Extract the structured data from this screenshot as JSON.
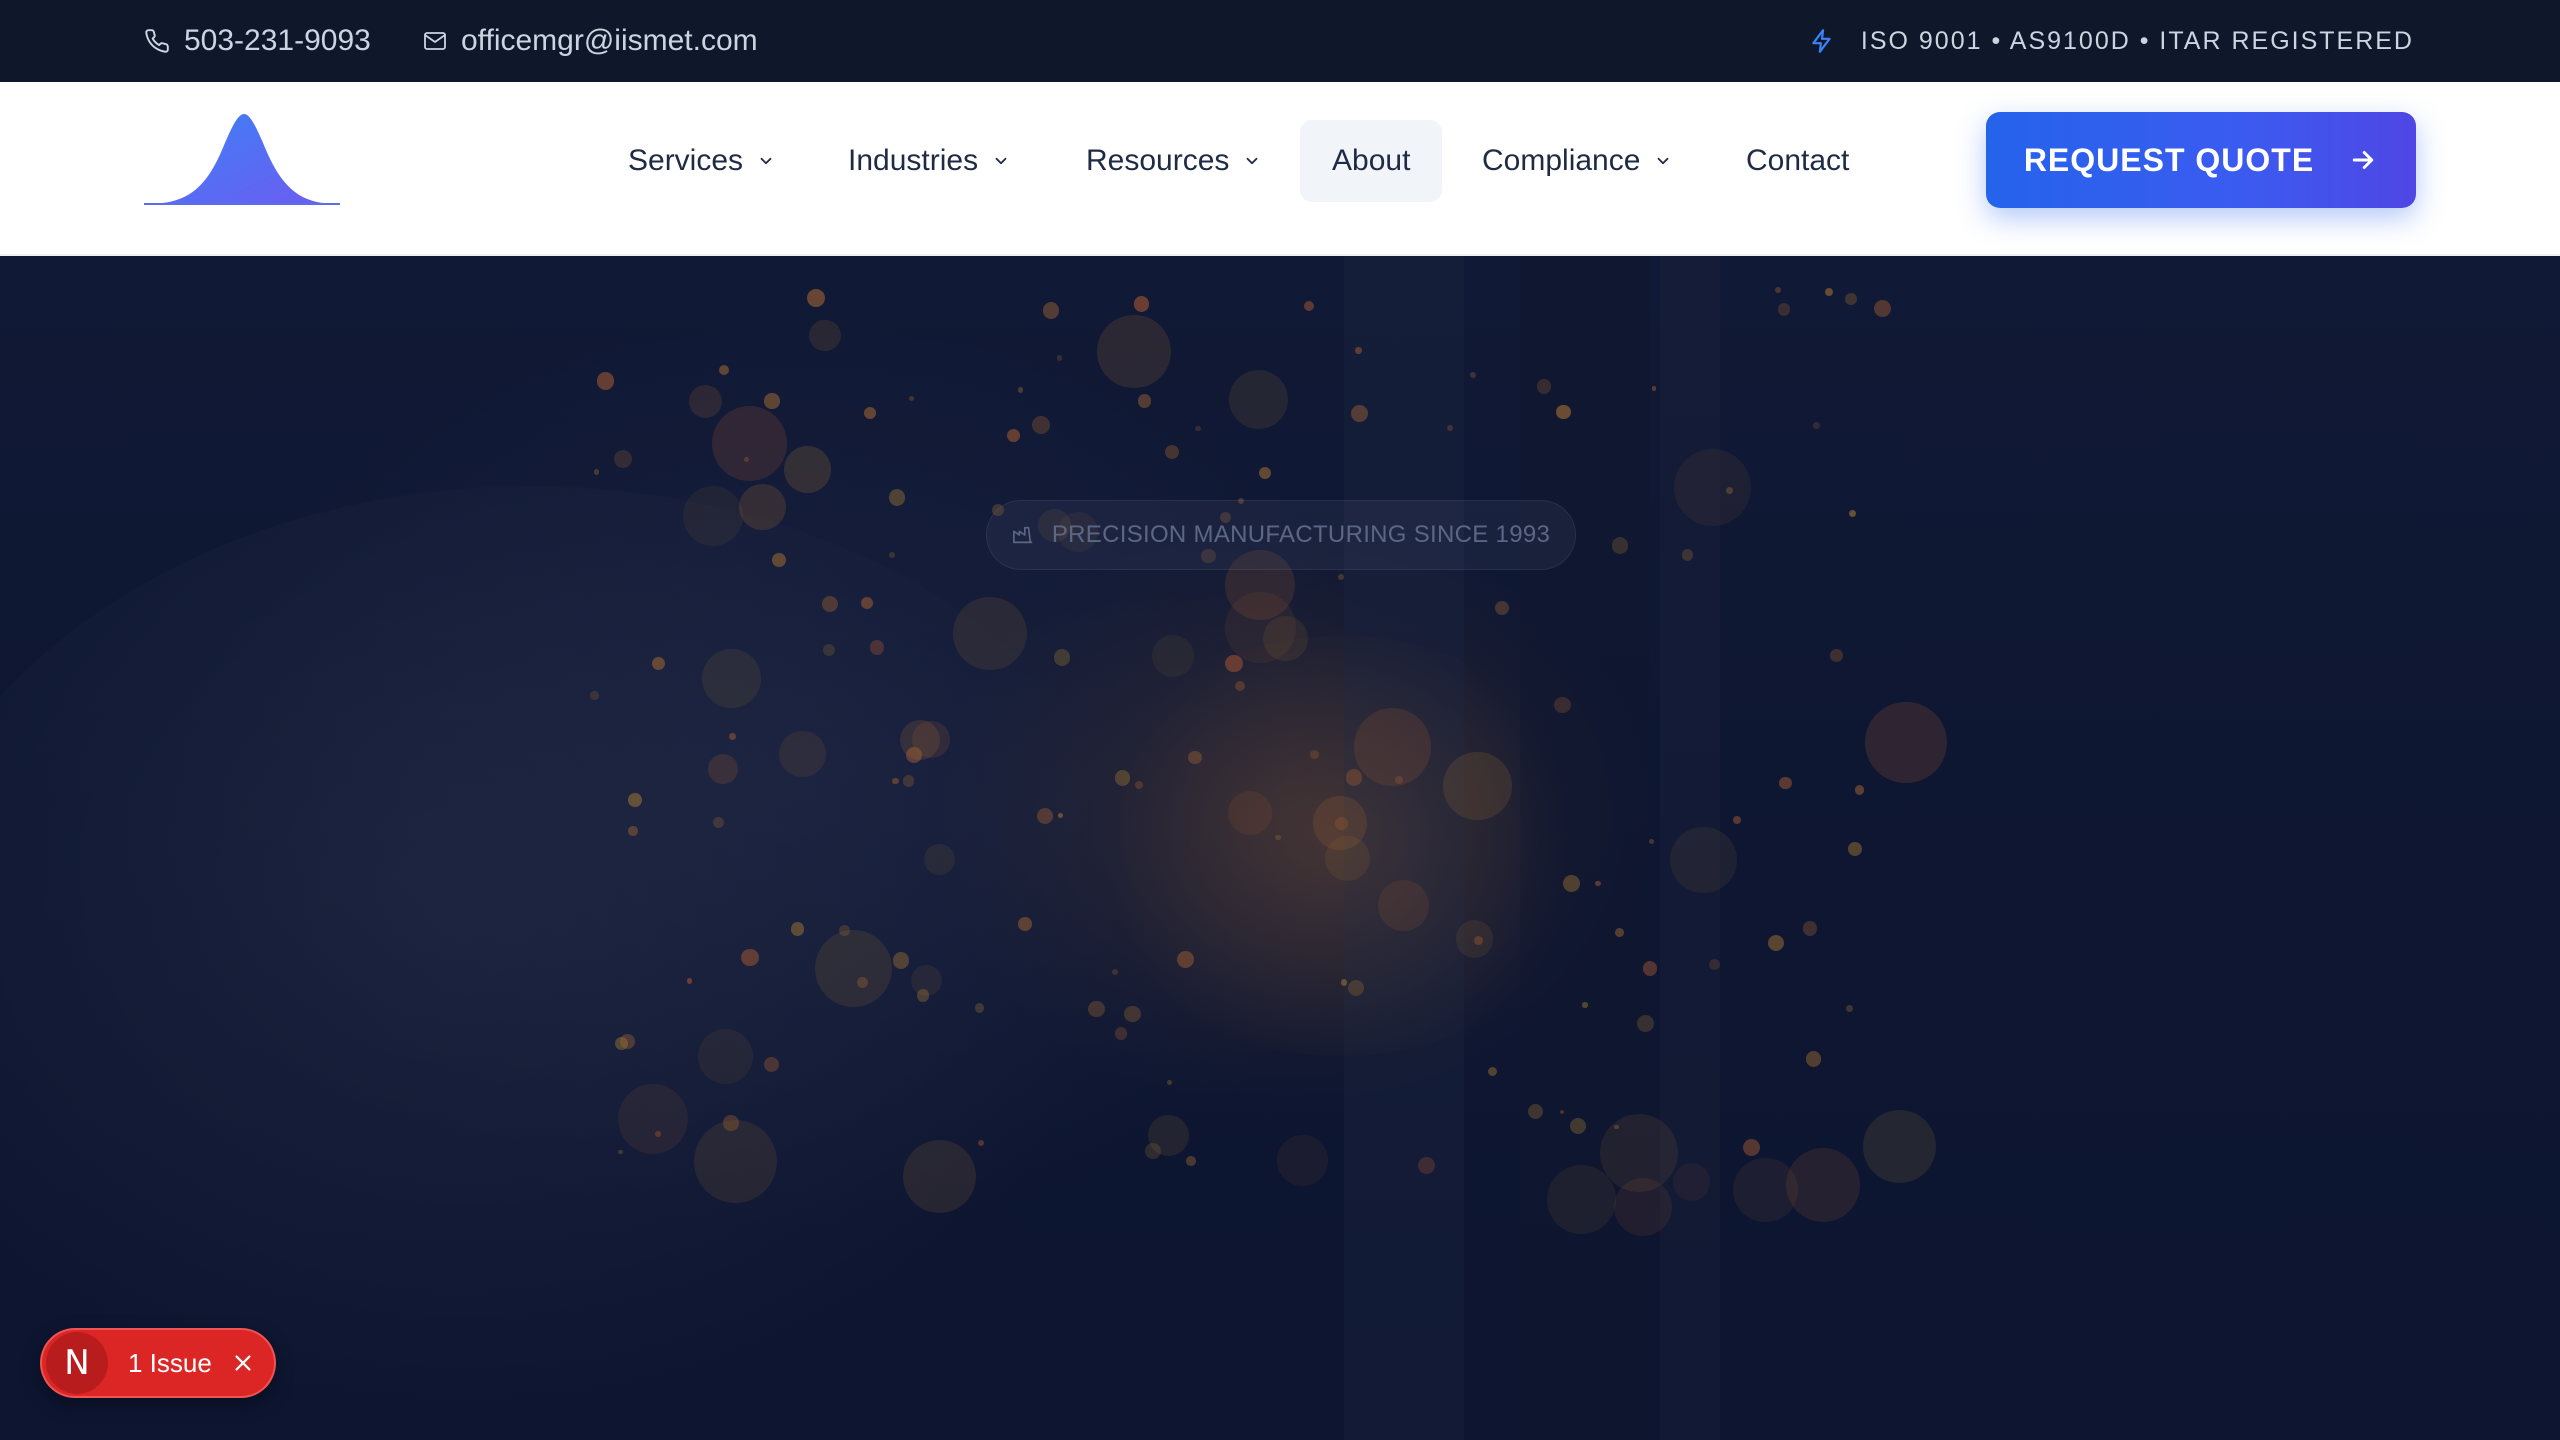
{
  "topbar": {
    "phone": "503-231-9093",
    "email": "officemgr@iismet.com",
    "certifications": "ISO 9001 • AS9100D • ITAR REGISTERED",
    "phone_icon": "phone-icon",
    "email_icon": "mail-icon",
    "cert_icon": "lightning-bolt-icon"
  },
  "nav": {
    "logo": "bell-curve-logo",
    "items": [
      {
        "label": "Services",
        "has_dropdown": true
      },
      {
        "label": "Industries",
        "has_dropdown": true
      },
      {
        "label": "Resources",
        "has_dropdown": true
      },
      {
        "label": "About",
        "has_dropdown": false,
        "active": true
      },
      {
        "label": "Compliance",
        "has_dropdown": true
      },
      {
        "label": "Contact",
        "has_dropdown": false
      }
    ],
    "cta": {
      "label": "REQUEST QUOTE",
      "icon": "arrow-right-icon"
    }
  },
  "hero": {
    "badge": "PRECISION MANUFACTURING SINCE 1993",
    "badge_icon": "factory-icon",
    "background": "welding-sparks-photo"
  },
  "dev_indicator": {
    "logo_letter": "N",
    "label": "1 Issue",
    "close_icon": "close-icon"
  },
  "colors": {
    "topbar_bg": "#0f172a",
    "accent": "#2563eb",
    "accent_end": "#4f46e5",
    "issue_red": "#dc2626",
    "nav_text": "#1f2a44"
  }
}
